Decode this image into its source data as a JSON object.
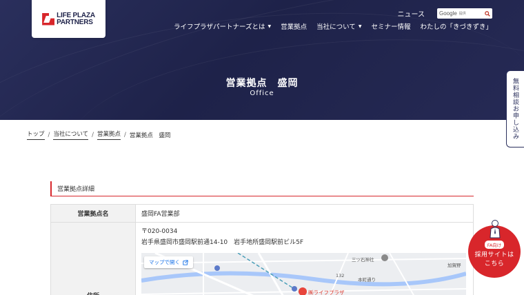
{
  "header": {
    "logo_line1": "LIFE PLAZA",
    "logo_line2": "PARTNERS",
    "news": "ニュース",
    "search": {
      "brand": "Google",
      "provided": "提供"
    },
    "nav": [
      {
        "label": "ライフプラザパートナーズとは",
        "dropdown": true
      },
      {
        "label": "営業拠点",
        "dropdown": false
      },
      {
        "label": "当社について",
        "dropdown": true
      },
      {
        "label": "セミナー情報",
        "dropdown": false
      },
      {
        "label": "わたしの「きづきずき」",
        "dropdown": false
      }
    ]
  },
  "hero": {
    "title": "営業拠点　盛岡",
    "subtitle": "Office"
  },
  "side_cta": "無料相談お申し込み",
  "breadcrumb": {
    "items": [
      "トップ",
      "当社について",
      "営業拠点"
    ],
    "current": "営業拠点　盛岡"
  },
  "section": {
    "heading": "営業拠点詳細"
  },
  "table": {
    "rows": [
      {
        "label": "営業拠点名",
        "value": "盛岡FA営業部"
      },
      {
        "label": "住所",
        "postal": "〒020-0034",
        "address": "岩手県盛岡市盛岡駅前通14-10　岩手地所盛岡駅前ビル5F"
      }
    ]
  },
  "map": {
    "open_label": "マップで開く",
    "labels": [
      "三ツ石神社",
      "加賀野",
      "132",
      "本町通り"
    ],
    "pin_label": "㈱ライフプラザ"
  },
  "fa_cta": {
    "badge": "FA向け",
    "line1": "採用サイトは",
    "line2": "こちら"
  },
  "colors": {
    "navy": "#1e2249",
    "accent": "#d8262b"
  }
}
